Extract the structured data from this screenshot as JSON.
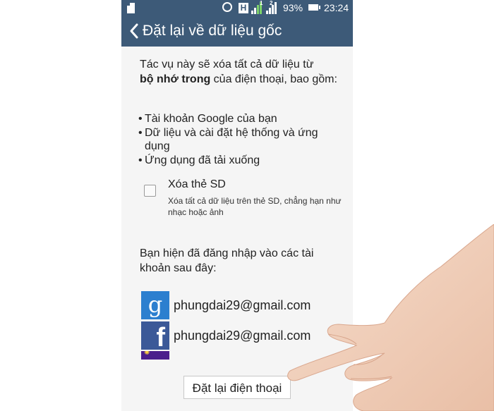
{
  "status_bar": {
    "battery_percent": "93%",
    "time": "23:24",
    "h_label": "H",
    "sim1": "1",
    "sim2": "2"
  },
  "app_bar": {
    "back_icon": "chevron-left-icon",
    "title": "Đặt lại về dữ liệu gốc"
  },
  "description": {
    "line_before_bold": "Tác vụ này sẽ xóa tất cả dữ liệu từ",
    "bold": "bộ nhớ trong",
    "line_after_bold": " của điện thoại, bao gồm:"
  },
  "bullets": [
    "Tài khoản Google của bạn",
    "Dữ liệu và cài đặt hệ thống và ứng dụng",
    "Ứng dụng đã tải xuống"
  ],
  "sd_option": {
    "checked": false,
    "title": "Xóa thẻ SD",
    "subtitle": "Xóa tất cả dữ liệu trên thẻ SD, chẳng hạn như nhạc hoặc ảnh"
  },
  "accounts_intro": "Bạn hiện đã đăng nhập vào các tài khoản sau đây:",
  "accounts": [
    {
      "icon": "google-icon",
      "logo_text": "g",
      "email": "phungdai29@gmail.com"
    },
    {
      "icon": "facebook-icon",
      "logo_text": "f",
      "email": "phungdai29@gmail.com"
    },
    {
      "icon": "yahoo-icon"
    }
  ],
  "reset_button": "Đặt lại điện thoại",
  "colors": {
    "bar": "#3d5a78",
    "background": "#f5f5f5",
    "google": "#2c7fcf",
    "facebook": "#3b5998"
  }
}
